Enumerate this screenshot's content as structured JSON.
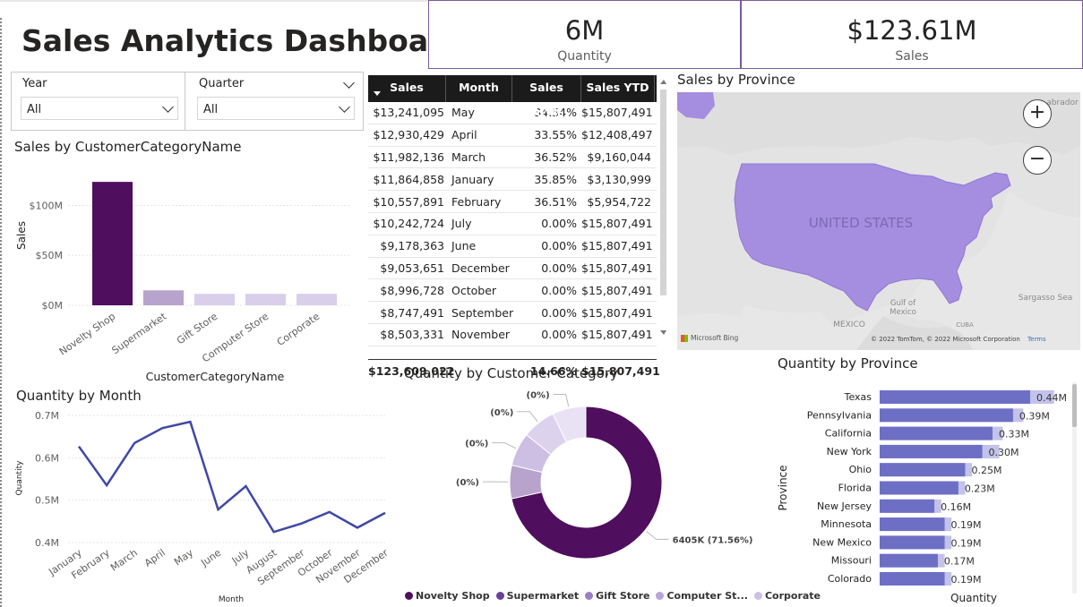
{
  "title": "Sales Analytics Dashboard",
  "kpis": {
    "quantity": {
      "value": "6M",
      "label": "Quantity"
    },
    "sales": {
      "value": "$123.61M",
      "label": "Sales"
    }
  },
  "slicers": {
    "year": {
      "label": "Year",
      "value": "All"
    },
    "quarter": {
      "label": "Quarter",
      "value": "All"
    }
  },
  "table": {
    "headers": [
      "Sales",
      "Month",
      "Sales YoY%",
      "Sales YTD"
    ],
    "rows": [
      [
        "$13,241,095",
        "May",
        "34.54%",
        "$15,807,491"
      ],
      [
        "$12,930,429",
        "April",
        "33.55%",
        "$12,408,497"
      ],
      [
        "$11,982,136",
        "March",
        "36.52%",
        "$9,160,044"
      ],
      [
        "$11,864,858",
        "January",
        "35.85%",
        "$3,130,999"
      ],
      [
        "$10,557,891",
        "February",
        "36.51%",
        "$5,954,722"
      ],
      [
        "$10,242,724",
        "July",
        "0.00%",
        "$15,807,491"
      ],
      [
        "$9,178,363",
        "June",
        "0.00%",
        "$15,807,491"
      ],
      [
        "$9,053,651",
        "December",
        "0.00%",
        "$15,807,491"
      ],
      [
        "$8,996,728",
        "October",
        "0.00%",
        "$15,807,491"
      ],
      [
        "$8,747,491",
        "September",
        "0.00%",
        "$15,807,491"
      ],
      [
        "$8,503,331",
        "November",
        "0.00%",
        "$15,807,491"
      ]
    ],
    "total": [
      "$123,609,022",
      "",
      "14.66%",
      "$15,807,491"
    ]
  },
  "map": {
    "title": "Sales by Province",
    "country_label": "UNITED STATES",
    "labels": {
      "mexico": "MEXICO",
      "gulf": "Gulf of\nMexico",
      "sargasso": "Sargasso Sea",
      "labrador": "abrador",
      "cuba": "CUBA"
    },
    "attribution": "© 2022 TomTom, © 2022 Microsoft Corporation",
    "terms": "Terms",
    "bing": "Microsoft Bing",
    "fill_color": "#a58de0"
  },
  "chart_data": [
    {
      "id": "sales-by-category",
      "type": "bar",
      "title": "Sales by CustomerCategoryName",
      "xlabel": "CustomerCategoryName",
      "ylabel": "Sales",
      "categories": [
        "Novelty Shop",
        "Supermarket",
        "Gift Store",
        "Computer Store",
        "Corporate"
      ],
      "values": [
        123.6,
        15.0,
        11.5,
        11.5,
        11.5
      ],
      "yticks": [
        "$0M",
        "$50M",
        "$100M"
      ],
      "ylim": [
        0,
        130
      ],
      "colors": [
        "#4f0e5e",
        "#b7a3cc",
        "#d9cfea",
        "#d9cfea",
        "#d9cfea"
      ]
    },
    {
      "id": "quantity-by-month",
      "type": "line",
      "title": "Quantity by Month",
      "xlabel": "Month",
      "ylabel": "Quantity",
      "categories": [
        "January",
        "February",
        "March",
        "April",
        "May",
        "June",
        "July",
        "August",
        "September",
        "October",
        "November",
        "December"
      ],
      "values": [
        0.627,
        0.535,
        0.635,
        0.67,
        0.685,
        0.478,
        0.533,
        0.425,
        0.445,
        0.472,
        0.435,
        0.47
      ],
      "yticks": [
        "0.4M",
        "0.5M",
        "0.6M",
        "0.7M"
      ],
      "ylim": [
        0.4,
        0.7
      ],
      "color": "#3f48a6"
    },
    {
      "id": "quantity-by-customer-category",
      "type": "pie",
      "title": "Quantity by Customer Category",
      "categories": [
        "Novelty Shop",
        "Supermarket",
        "Gift Store",
        "Computer St...",
        "Corporate"
      ],
      "values": [
        71.56,
        7.1,
        7.1,
        7.1,
        7.1
      ],
      "slice_labels": [
        "6405K (71.56%)",
        "(0%)",
        "(0%)",
        "(0%)",
        "(0%)"
      ],
      "colors": [
        "#4f0e5e",
        "#b7a3cc",
        "#cdbfe3",
        "#ddd2ee",
        "#e9e2f4"
      ],
      "legend_colors": [
        "#4f0e5e",
        "#6a3f96",
        "#9a7fc4",
        "#b7a3d6",
        "#cdbfe6"
      ]
    },
    {
      "id": "quantity-by-province",
      "type": "bar",
      "title": "Quantity by Province",
      "xlabel": "Quantity",
      "ylabel": "Province",
      "categories": [
        "Texas",
        "Pennsylvania",
        "California",
        "New York",
        "Ohio",
        "Florida",
        "New Jersey",
        "Minnesota",
        "New Mexico",
        "Missouri",
        "Colorado"
      ],
      "values": [
        0.44,
        0.39,
        0.33,
        0.3,
        0.25,
        0.23,
        0.16,
        0.19,
        0.19,
        0.17,
        0.19
      ],
      "value_labels": [
        "0.44M",
        "0.39M",
        "0.33M",
        "0.30M",
        "0.25M",
        "0.23M",
        "0.16M",
        "0.19M",
        "0.19M",
        "0.17M",
        "0.19M"
      ],
      "target_values": [
        0.51,
        0.42,
        0.36,
        0.35,
        0.27,
        0.25,
        0.18,
        0.21,
        0.21,
        0.19,
        0.21
      ],
      "xlim": [
        0,
        0.55
      ],
      "colors": {
        "bar": "#6d6fc5",
        "target": "#c2c2ea"
      }
    }
  ]
}
